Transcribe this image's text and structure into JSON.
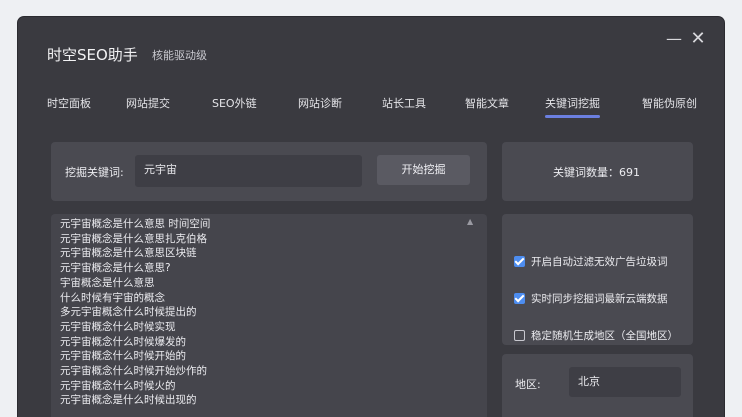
{
  "window": {
    "title": "时空SEO助手",
    "subtitle": "核能驱动级",
    "minimize_glyph": "—",
    "close_glyph": "✕"
  },
  "tabs": [
    {
      "label": "时空面板",
      "active": false
    },
    {
      "label": "网站提交",
      "active": false
    },
    {
      "label": "SEO外链",
      "active": false
    },
    {
      "label": "网站诊断",
      "active": false
    },
    {
      "label": "站长工具",
      "active": false
    },
    {
      "label": "智能文章",
      "active": false
    },
    {
      "label": "关键词挖掘",
      "active": true
    },
    {
      "label": "智能伪原创",
      "active": false
    }
  ],
  "search": {
    "label": "挖掘关键词:",
    "value": "元宇宙",
    "button": "开始挖掘"
  },
  "count": {
    "text": "关键词数量：691"
  },
  "keywords": [
    "元宇宙概念是什么意思 时间空间",
    "元宇宙概念是什么意思扎克伯格",
    "元宇宙概念是什么意思区块链",
    "元宇宙概念是什么意思?",
    "宇宙概念是什么意思",
    "什么时候有宇宙的概念",
    "多元宇宙概念什么时候提出的",
    "元宇宙概念什么时候实现",
    "元宇宙概念什么时候爆发的",
    "元宇宙概念什么时候开始的",
    "元宇宙概念什么时候开始炒作的",
    "元宇宙概念什么时候火的",
    "元宇宙概念是什么时候出现的"
  ],
  "options": [
    {
      "label": "开启自动过滤无效广告垃圾词",
      "checked": true
    },
    {
      "label": "实时同步挖掘词最新云端数据",
      "checked": true
    },
    {
      "label": "稳定随机生成地区（全国地区）",
      "checked": false
    }
  ],
  "region": {
    "label": "地区:",
    "value": "北京"
  },
  "colors": {
    "window_bg": "#3a3a40",
    "panel_bg": "#4a4a51",
    "accent": "#6b7fe0",
    "checkbox": "#4d8df0"
  }
}
